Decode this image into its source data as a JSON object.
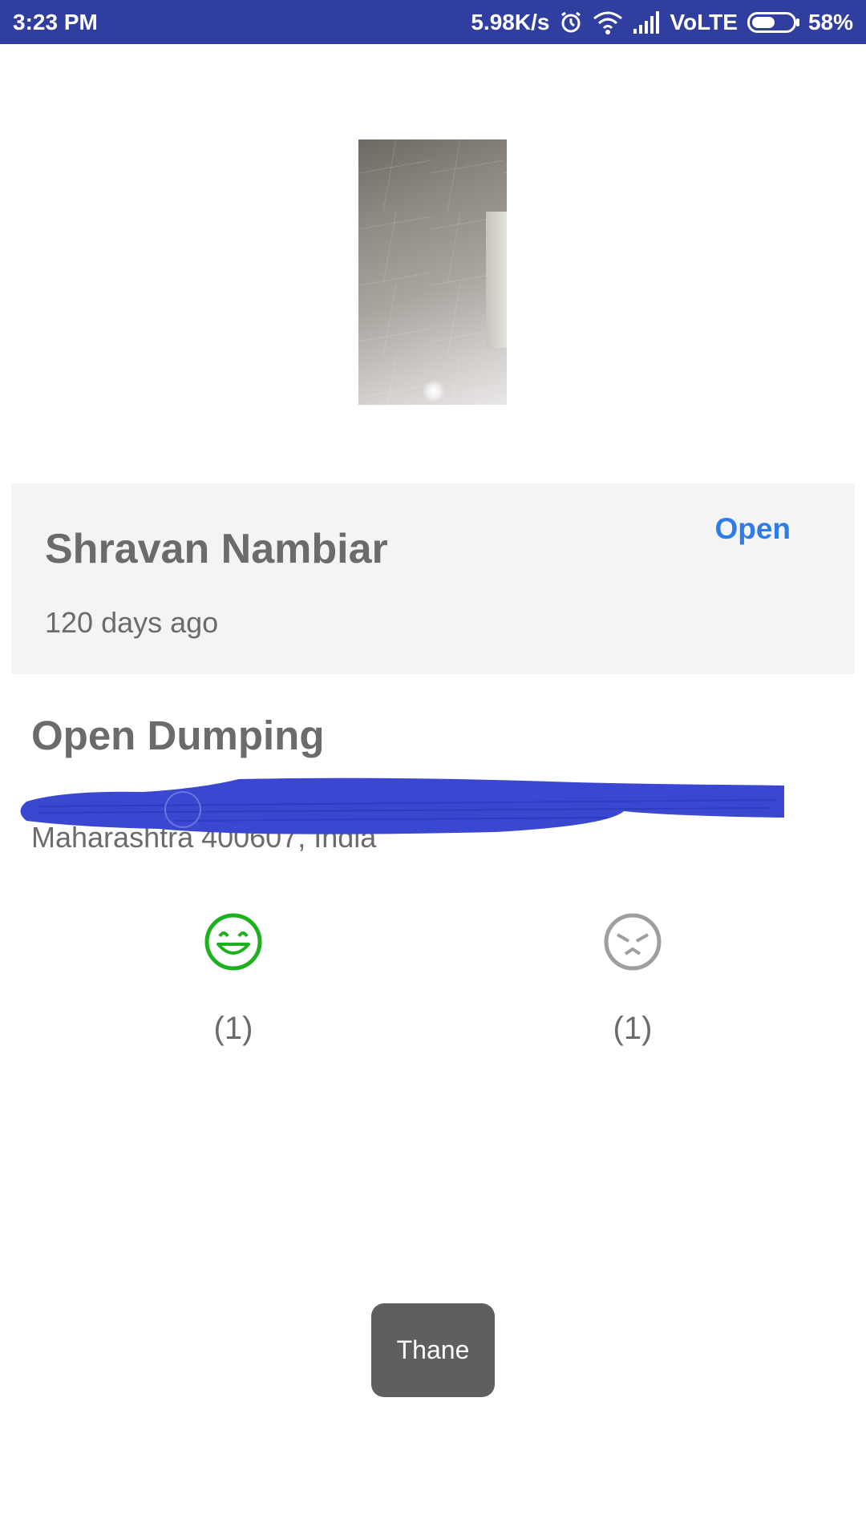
{
  "status_bar": {
    "time": "3:23 PM",
    "network_speed": "5.98K/s",
    "network_type": "VoLTE",
    "battery_percent": "58%",
    "battery_level": 0.58,
    "icons": [
      "alarm-icon",
      "wifi-icon",
      "signal-icon",
      "battery-icon"
    ]
  },
  "complaint": {
    "photo": "floor-tiles-photo",
    "reporter_name": "Shravan Nambiar",
    "time_ago": "120 days ago",
    "status": "Open",
    "title": "Open Dumping",
    "address_line": "Maharashtra 400607, India",
    "upvote_count": "(1)",
    "downvote_count": "(1)"
  },
  "toast": {
    "text": "Thane"
  },
  "colors": {
    "status_bar": "#303f9f",
    "status_link": "#2f7be8",
    "upvote": "#1db11d",
    "downvote": "#9e9e9e",
    "redaction": "#3a47d1",
    "toast": "#5f5f5f"
  }
}
